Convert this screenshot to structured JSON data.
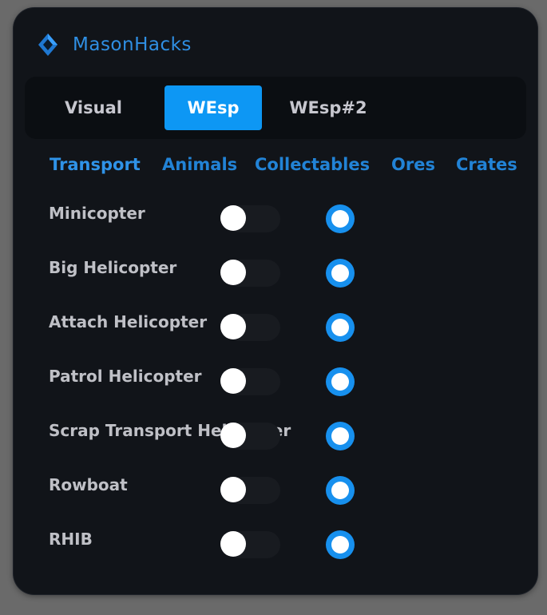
{
  "app": {
    "title": "MasonHacks",
    "logo_icon": "diamond-logo-icon",
    "accent_color": "#0d97f4"
  },
  "tabs": [
    {
      "label": "Visual",
      "active": false
    },
    {
      "label": "WEsp",
      "active": true
    },
    {
      "label": "WEsp#2",
      "active": false
    }
  ],
  "subtabs": [
    {
      "label": "Transport",
      "active": true
    },
    {
      "label": "Animals",
      "active": false
    },
    {
      "label": "Collectables",
      "active": false
    },
    {
      "label": "Ores",
      "active": false
    },
    {
      "label": "Crates",
      "active": false
    }
  ],
  "items": [
    {
      "label": "Minicopter",
      "enabled": false,
      "color": "#1790ee"
    },
    {
      "label": "Big Helicopter",
      "enabled": false,
      "color": "#1790ee"
    },
    {
      "label": "Attach Helicopter",
      "enabled": false,
      "color": "#1790ee"
    },
    {
      "label": "Patrol Helicopter",
      "enabled": false,
      "color": "#1790ee"
    },
    {
      "label": "Scrap Transport Helicopter",
      "enabled": false,
      "color": "#1790ee"
    },
    {
      "label": "Rowboat",
      "enabled": false,
      "color": "#1790ee"
    },
    {
      "label": "RHIB",
      "enabled": false,
      "color": "#1790ee"
    }
  ]
}
